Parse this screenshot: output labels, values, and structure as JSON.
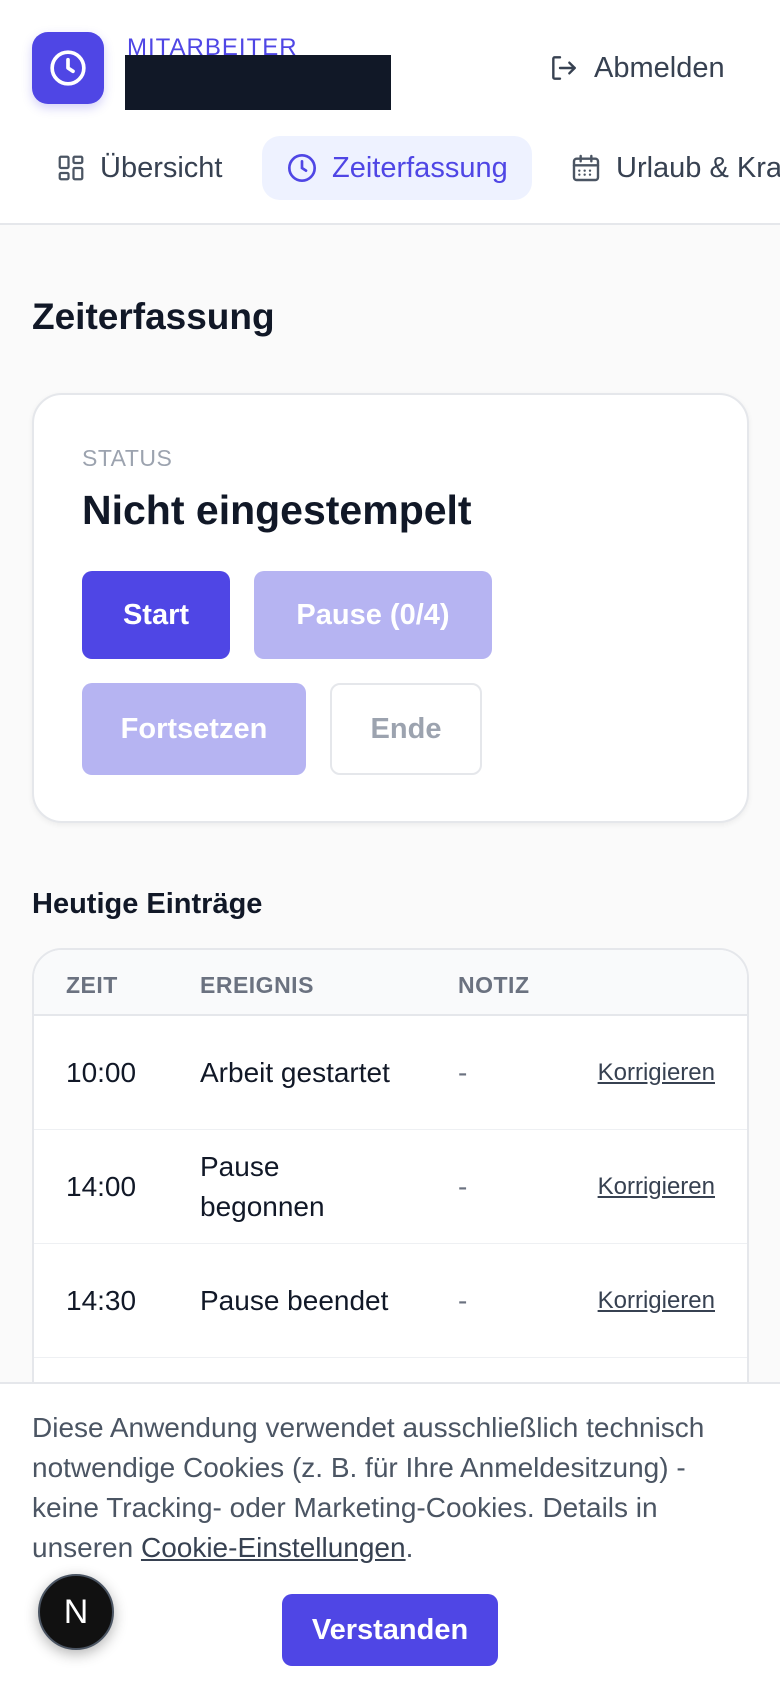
{
  "header": {
    "role": "MITARBEITER",
    "logout_label": "Abmelden"
  },
  "tabs": [
    {
      "label": "Übersicht",
      "icon": "grid-icon"
    },
    {
      "label": "Zeiterfassung",
      "icon": "clock-icon",
      "active": true
    },
    {
      "label": "Urlaub & Krankmeldung",
      "icon": "calendar-icon"
    }
  ],
  "main": {
    "title": "Zeiterfassung",
    "status": {
      "label": "STATUS",
      "value": "Nicht eingestempelt",
      "buttons": {
        "start": "Start",
        "pause": "Pause (0/4)",
        "resume": "Fortsetzen",
        "end": "Ende"
      }
    },
    "entries": {
      "title": "Heutige Einträge",
      "columns": [
        "ZEIT",
        "EREIGNIS",
        "NOTIZ"
      ],
      "rows": [
        {
          "time": "10:00",
          "event": "Arbeit gestartet",
          "note": "-",
          "action": "Korrigieren"
        },
        {
          "time": "14:00",
          "event": "Pause begonnen",
          "note": "-",
          "action": "Korrigieren"
        },
        {
          "time": "14:30",
          "event": "Pause beendet",
          "note": "-",
          "action": "Korrigieren"
        }
      ]
    }
  },
  "cookie": {
    "text": "Diese Anwendung verwendet ausschließlich technisch notwendige Cookies (z. B. für Ihre Anmeldesitzung) - keine Tracking- oder Marketing-Cookies. Details in unseren ",
    "link": "Cookie-Einstellungen",
    "suffix": ".",
    "button": "Verstanden"
  },
  "dev_badge": "N",
  "colors": {
    "accent": "#4f46e5",
    "accent_light": "#eef2ff",
    "disabled": "#b6b4f2",
    "text": "#111827"
  }
}
